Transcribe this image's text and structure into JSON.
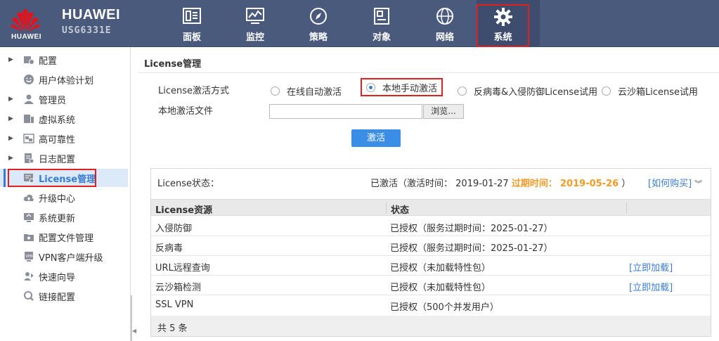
{
  "header": {
    "logo_text": "HUAWEI",
    "brand": "HUAWEI",
    "model": "USG6331E",
    "nav": [
      {
        "label": "面板",
        "icon": "dashboard-icon"
      },
      {
        "label": "监控",
        "icon": "monitor-icon"
      },
      {
        "label": "策略",
        "icon": "compass-icon"
      },
      {
        "label": "对象",
        "icon": "object-icon"
      },
      {
        "label": "网络",
        "icon": "globe-icon"
      },
      {
        "label": "系统",
        "icon": "gear-icon",
        "active": true
      }
    ]
  },
  "sidebar": {
    "items": [
      {
        "label": "配置",
        "expandable": true,
        "icon": "config-icon"
      },
      {
        "label": "用户体验计划",
        "expandable": false,
        "icon": "smiley-icon"
      },
      {
        "label": "管理员",
        "expandable": true,
        "icon": "admin-icon"
      },
      {
        "label": "虚拟系统",
        "expandable": true,
        "icon": "virtual-system-icon"
      },
      {
        "label": "高可靠性",
        "expandable": true,
        "icon": "ha-icon"
      },
      {
        "label": "日志配置",
        "expandable": true,
        "icon": "log-icon"
      },
      {
        "label": "License管理",
        "expandable": false,
        "icon": "license-icon",
        "active": true
      },
      {
        "label": "升级中心",
        "expandable": false,
        "icon": "cloud-upgrade-icon"
      },
      {
        "label": "系统更新",
        "expandable": false,
        "icon": "system-update-icon"
      },
      {
        "label": "配置文件管理",
        "expandable": false,
        "icon": "folder-icon"
      },
      {
        "label": "VPN客户端升级",
        "expandable": false,
        "icon": "vpn-icon"
      },
      {
        "label": "快速向导",
        "expandable": false,
        "icon": "wizard-icon"
      },
      {
        "label": "链接配置",
        "expandable": false,
        "icon": "link-icon"
      }
    ]
  },
  "main": {
    "title": "License管理",
    "activation_mode_label": "License激活方式",
    "radios": [
      {
        "label": "在线自动激活",
        "checked": false
      },
      {
        "label": "本地手动激活",
        "checked": true
      },
      {
        "label": "反病毒&入侵防御License试用",
        "checked": false
      },
      {
        "label": "云沙箱License试用",
        "checked": false
      }
    ],
    "file_label": "本地激活文件",
    "file_value": "",
    "browse_label": "浏览...",
    "activate_label": "激活",
    "status": {
      "label": "License状态：",
      "activated_text": "已激活（激活时间：",
      "activated_date": "2019-01-27",
      "expire_label": "过期时间：",
      "expire_date": "2019-05-26",
      "close_paren": "）",
      "buy_link": "[如何购买]"
    },
    "table": {
      "headers": [
        "License资源",
        "状态",
        ""
      ],
      "rows": [
        {
          "resource": "入侵防御",
          "status": "已授权（服务过期时间：2025-01-27）",
          "action": ""
        },
        {
          "resource": "反病毒",
          "status": "已授权（服务过期时间：2025-01-27）",
          "action": ""
        },
        {
          "resource": "URL远程查询",
          "status": "已授权（未加载特性包）",
          "action": "[立即加载]"
        },
        {
          "resource": "云沙箱检测",
          "status": "已授权（未加载特性包）",
          "action": "[立即加载]"
        },
        {
          "resource": "SSL VPN",
          "status": "已授权（500个并发用户）",
          "action": ""
        }
      ],
      "footer": "共 5 条"
    }
  },
  "colors": {
    "header_bg": "#4a5a7c",
    "accent": "#3a7bd5",
    "expire": "#f39a26",
    "highlight_outline": "#e02020"
  }
}
